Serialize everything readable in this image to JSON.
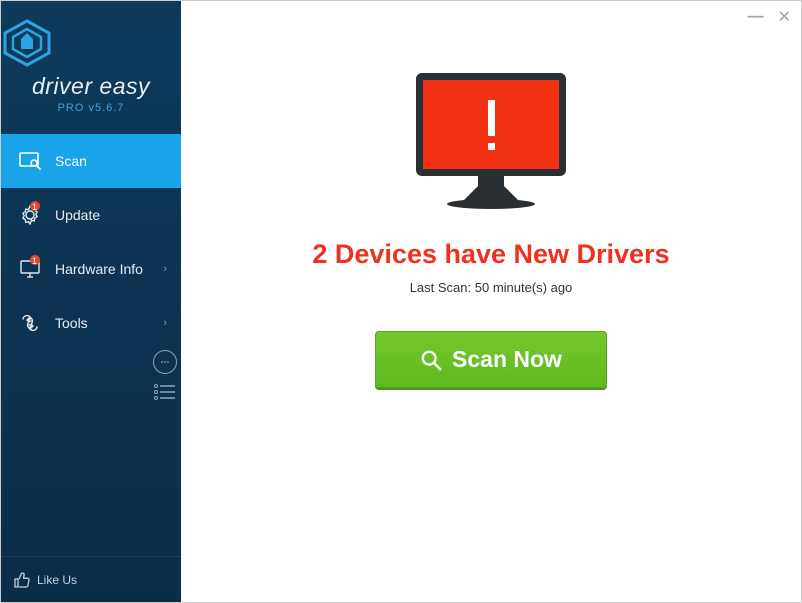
{
  "app": {
    "name": "driver easy",
    "version_label": "PRO v5.6.7"
  },
  "nav": {
    "scan": "Scan",
    "update": "Update",
    "hardware": "Hardware Info",
    "tools": "Tools",
    "update_badge": "1"
  },
  "footer": {
    "like": "Like Us"
  },
  "main": {
    "status": "2 Devices have New Drivers",
    "lastscan": "Last Scan: 50 minute(s) ago",
    "scan_button": "Scan Now"
  }
}
